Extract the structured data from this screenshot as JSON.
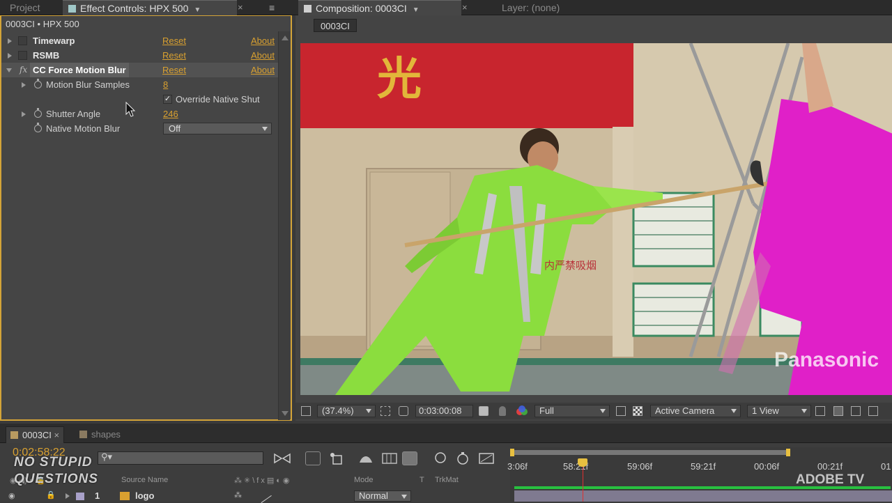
{
  "top_tabs": {
    "project": "Project",
    "effect_controls": "Effect Controls: HPX 500",
    "composition": "Composition: 0003CI",
    "layer": "Layer: (none)",
    "close": "×"
  },
  "effect_controls": {
    "header": "0003CI • HPX 500",
    "effects": [
      {
        "name": "Timewarp",
        "reset": "Reset",
        "about": "About"
      },
      {
        "name": "RSMB",
        "reset": "Reset",
        "about": "About"
      },
      {
        "name": "CC Force Motion Blur",
        "reset": "Reset",
        "about": "About",
        "fx": "fx"
      }
    ],
    "params": [
      {
        "name": "Motion Blur Samples",
        "value": "8"
      },
      {
        "name": "Override Native Shut",
        "checked": true
      },
      {
        "name": "Shutter Angle",
        "value": "246"
      },
      {
        "name": "Native Motion Blur",
        "value": "Off"
      }
    ]
  },
  "composition": {
    "tab": "0003CI",
    "scene_text": {
      "banner_char": "光",
      "sign": "内严禁吸烟",
      "watermark": "Panasonic"
    },
    "bottom_bar": {
      "zoom": "(37.4%)",
      "timecode": "0:03:00:08",
      "resolution": "Full",
      "camera": "Active Camera",
      "views": "1 View"
    }
  },
  "timeline": {
    "tabs": [
      {
        "label": "0003CI",
        "active": true,
        "color": "#b89a60"
      },
      {
        "label": "shapes",
        "active": false,
        "color": "#8a7a60"
      }
    ],
    "timecode": "0:02:58:22",
    "columns": {
      "source_name": "Source Name",
      "mode": "Mode",
      "t": "T",
      "trkmat": "TrkMat"
    },
    "layer": {
      "index": "1",
      "name": "logo",
      "mode": "Normal"
    },
    "ruler_ticks": [
      "3:06f",
      "58:21f",
      "59:06f",
      "59:21f",
      "00:06f",
      "00:21f",
      "01"
    ]
  },
  "watermarks": {
    "nsq_line1": "NO STUPID",
    "nsq_line2": "QUESTIONS",
    "adobe_tv": "ADOBE TV"
  },
  "colors": {
    "accent": "#d8a030",
    "panel_border": "#d4a438",
    "playhead": "#e03030"
  }
}
